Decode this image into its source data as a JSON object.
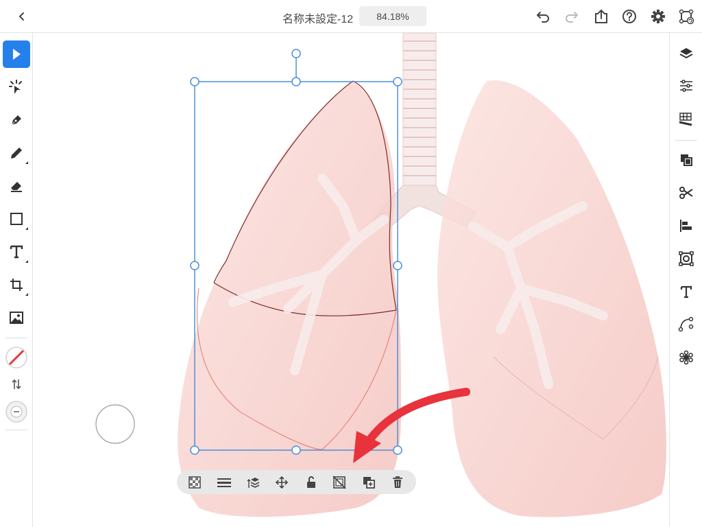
{
  "header": {
    "document_title": "名称未設定-12",
    "zoom_level": "84.18%"
  },
  "icons": {
    "back": "chevron-left-icon",
    "undo": "undo-icon",
    "redo": "redo-icon",
    "share": "share-icon",
    "help": "help-icon",
    "settings": "gear-icon",
    "cloud": "cloud-sync-icon"
  },
  "left_tools": [
    "select",
    "direct-select",
    "pen",
    "pencil",
    "eraser",
    "rectangle",
    "type",
    "transform",
    "image-place",
    "stroke-color",
    "swap-fill-stroke",
    "add-stroke"
  ],
  "right_tools": [
    "layers",
    "properties",
    "grid-settings",
    "arrange",
    "shape-builder",
    "align",
    "repeat-grid",
    "type-properties",
    "path-edit",
    "effects"
  ],
  "bottom_toolbar": [
    "opacity",
    "stroke-weight",
    "arrange-layers",
    "move",
    "unlock",
    "no-fill",
    "duplicate",
    "delete"
  ],
  "colors": {
    "accent": "#2680eb",
    "selection": "#4a90d9",
    "lung_fill": "#f5c9c4",
    "arrow": "#e8323c",
    "stroke_none": "#e03a3a"
  }
}
